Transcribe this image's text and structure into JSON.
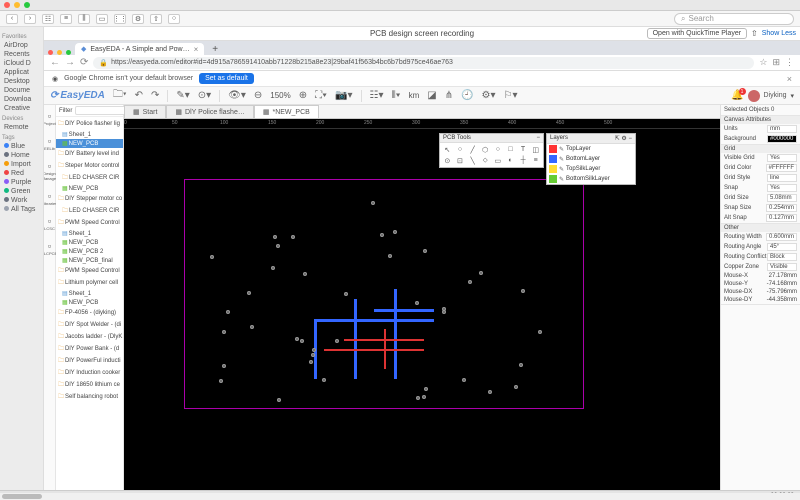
{
  "mac": {
    "search_placeholder": "Search",
    "finder_sidebar": {
      "favorites_hdr": "Favorites",
      "favorites": [
        "AirDrop",
        "Recents",
        "iCloud D",
        "Applicat",
        "Desktop",
        "Docume",
        "Downloa",
        "Creative"
      ],
      "devices_hdr": "Devices",
      "devices": [
        "Remote"
      ],
      "tags_hdr": "Tags",
      "tags": [
        {
          "label": "Blue",
          "color": "#3b82f6"
        },
        {
          "label": "Home",
          "color": "#6b7280"
        },
        {
          "label": "Import",
          "color": "#f59e0b"
        },
        {
          "label": "Red",
          "color": "#ef4444"
        },
        {
          "label": "Purple",
          "color": "#8b5cf6"
        },
        {
          "label": "Green",
          "color": "#10b981"
        },
        {
          "label": "Work",
          "color": "#6b7280"
        },
        {
          "label": "All Tags",
          "color": "#9ca3af"
        }
      ]
    },
    "window_title": "PCB design screen recording",
    "open_with": "Open with QuickTime Player",
    "show_less": "Show Less"
  },
  "browser": {
    "tab_title": "EasyEDA - A Simple and Pow…",
    "url": "https://easyeda.com/editor#id=4d915a786591410abb71228b215a8e23|29baf41f563b4bc6b7bd975ce46ae763",
    "info_msg": "Google Chrome isn't your default browser",
    "set_default": "Set as default"
  },
  "app": {
    "brand": "EasyEDA",
    "zoom": "150%",
    "unit": "km",
    "user": "Diyking",
    "notif": "1",
    "far_left": [
      "Project",
      "EELib",
      "Design Manager",
      "Libraries",
      "LCSC",
      "JLCPCB"
    ],
    "filter_label": "Filter",
    "tree": [
      {
        "t": "f",
        "i": 0,
        "l": "DlY Police flasher lig"
      },
      {
        "t": "s",
        "i": 1,
        "l": "Sheet_1"
      },
      {
        "t": "p",
        "i": 1,
        "l": "NEW_PCB",
        "sel": true
      },
      {
        "t": "f",
        "i": 0,
        "l": "DlY Battery level ind"
      },
      {
        "t": "f",
        "i": 0,
        "l": "Steper Motor control"
      },
      {
        "t": "f",
        "i": 1,
        "l": "LED CHASER CIR"
      },
      {
        "t": "p",
        "i": 1,
        "l": "NEW_PCB"
      },
      {
        "t": "f",
        "i": 0,
        "l": "DlY Stepper motor co"
      },
      {
        "t": "f",
        "i": 1,
        "l": "LED CHASER CIR"
      },
      {
        "t": "f",
        "i": 0,
        "l": "PWM Speed Control"
      },
      {
        "t": "s",
        "i": 1,
        "l": "Sheet_1"
      },
      {
        "t": "p",
        "i": 1,
        "l": "NEW_PCB"
      },
      {
        "t": "p",
        "i": 1,
        "l": "NEW_PCB 2"
      },
      {
        "t": "p",
        "i": 1,
        "l": "NEW_PCB_final"
      },
      {
        "t": "f",
        "i": 0,
        "l": "PWM Speed Control"
      },
      {
        "t": "f",
        "i": 0,
        "l": "Lithium polymer cell"
      },
      {
        "t": "s",
        "i": 1,
        "l": "Sheet_1"
      },
      {
        "t": "p",
        "i": 1,
        "l": "NEW_PCB"
      },
      {
        "t": "f",
        "i": 0,
        "l": "FP-4056 - (diyking)"
      },
      {
        "t": "f",
        "i": 0,
        "l": "DlY Spot Welder - (di"
      },
      {
        "t": "f",
        "i": 0,
        "l": "Jacobs ladder - (DlyK"
      },
      {
        "t": "f",
        "i": 0,
        "l": "DlY Power Bank - (d"
      },
      {
        "t": "f",
        "i": 0,
        "l": "DlY PowerFul inducti"
      },
      {
        "t": "f",
        "i": 0,
        "l": "DlY Induction cooker"
      },
      {
        "t": "f",
        "i": 0,
        "l": "DlY 18650 lithium ce"
      },
      {
        "t": "f",
        "i": 0,
        "l": "Self balancing robot"
      }
    ],
    "doc_tabs": [
      {
        "label": "Start",
        "active": false,
        "dirty": false
      },
      {
        "label": "DlY Police flashe…",
        "active": false,
        "dirty": false
      },
      {
        "label": "*NEW_PCB",
        "active": true,
        "dirty": true
      }
    ],
    "ruler_marks": [
      0,
      50,
      100,
      150,
      200,
      250,
      300,
      350,
      400,
      450,
      500
    ],
    "pcb_tools_title": "PCB Tools",
    "layers": {
      "title": "Layers",
      "items": [
        {
          "name": "TopLayer",
          "color": "#ff3333"
        },
        {
          "name": "BottomLayer",
          "color": "#3366ff"
        },
        {
          "name": "TopSilkLayer",
          "color": "#ffdd33"
        },
        {
          "name": "BottomSilkLayer",
          "color": "#66cc33"
        }
      ]
    },
    "right": {
      "selected": "Selected Objects   0",
      "canvas_hdr": "Canvas Attributes",
      "units_l": "Units",
      "units_v": "mm",
      "bg_l": "Background",
      "bg_v": "#000000",
      "grid_hdr": "Grid",
      "vis_l": "Visible Grid",
      "vis_v": "Yes",
      "gcol_l": "Grid Color",
      "gcol_v": "#FFFFFF",
      "gstyle_l": "Grid Style",
      "gstyle_v": "line",
      "snap_l": "Snap",
      "snap_v": "Yes",
      "gsize_l": "Grid Size",
      "gsize_v": "5.08mm",
      "ssize_l": "Snap Size",
      "ssize_v": "0.254mm",
      "asnap_l": "Alt Snap",
      "asnap_v": "0.127mm",
      "other_hdr": "Other",
      "rw_l": "Routing Width",
      "rw_v": "0.600mm",
      "ra_l": "Routing Angle",
      "ra_v": "45°",
      "rc_l": "Routing Conflict",
      "rc_v": "Block",
      "cz_l": "Copper Zone",
      "cz_v": "Visible",
      "mx_l": "Mouse-X",
      "mx_v": "27.178mm",
      "my_l": "Mouse-Y",
      "my_v": "-74.168mm",
      "mdx_l": "Mouse-DX",
      "mdx_v": "-75.796mm",
      "mdy_l": "Mouse-DY",
      "mdy_v": "-44.358mm"
    }
  },
  "video_time": "00:00:23"
}
